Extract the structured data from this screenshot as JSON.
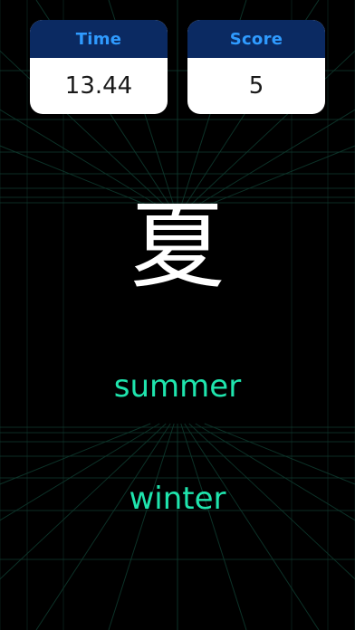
{
  "colors": {
    "background": "#000000",
    "grid": "#0f3b2f",
    "card_header": "#0b2a62",
    "card_header_text": "#2f9bff",
    "card_body": "#ffffff",
    "answer_text": "#1fe4ad",
    "kanji_text": "#ffffff"
  },
  "hud": {
    "time_label": "Time",
    "time_value": "13.44",
    "score_label": "Score",
    "score_value": "5"
  },
  "question": {
    "kanji": "夏"
  },
  "answers": [
    {
      "label": "summer"
    },
    {
      "label": "winter"
    }
  ]
}
